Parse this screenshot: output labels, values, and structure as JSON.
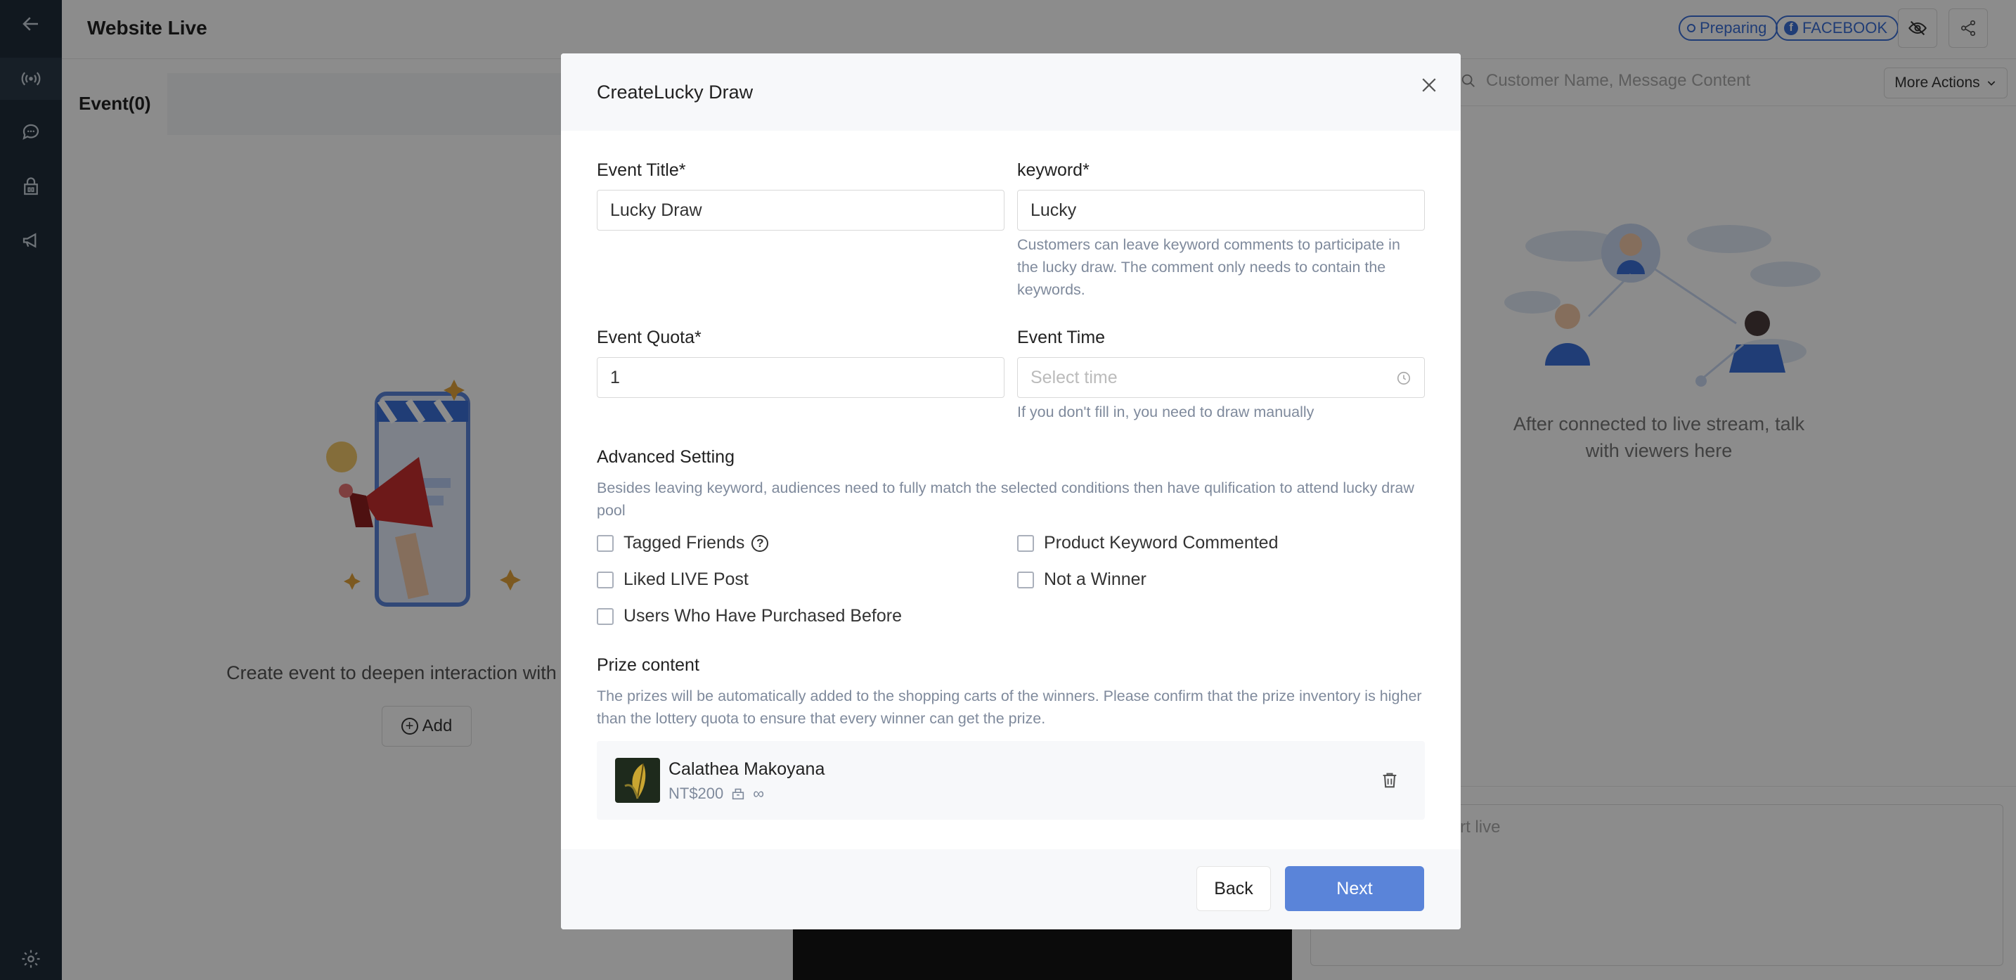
{
  "header": {
    "title": "Website Live",
    "status_pill": "Preparing",
    "platform_pill": "FACEBOOK",
    "platform_initial": "f"
  },
  "sidebar": {
    "icons": [
      "back-arrow-icon",
      "live-broadcast-icon",
      "chat-icon",
      "shop-icon",
      "megaphone-icon",
      "settings-icon"
    ]
  },
  "events_panel": {
    "tab_label": "Event(0)",
    "empty_text": "Create event to deepen interaction with",
    "add_label": "Add"
  },
  "right_panel": {
    "search_placeholder": "Customer Name, Message Content",
    "more_actions_label": "More Actions",
    "empty_text": "After connected to live stream, talk with viewers here",
    "comment_placeholder": "ment after you start live"
  },
  "modal": {
    "title": "CreateLucky Draw",
    "event_title_label": "Event Title*",
    "event_title_value": "Lucky Draw",
    "keyword_label": "keyword*",
    "keyword_value": "Lucky",
    "keyword_hint": "Customers can leave keyword comments to participate in the lucky draw. The comment only needs to contain the keywords.",
    "quota_label": "Event Quota*",
    "quota_value": "1",
    "time_label": "Event Time",
    "time_placeholder": "Select time",
    "time_hint": "If you don't fill in, you need to draw manually",
    "advanced_label": "Advanced Setting",
    "advanced_hint": "Besides leaving keyword, audiences need to fully match the selected conditions then have qulification to attend lucky draw pool",
    "conditions": {
      "tagged_friends": "Tagged Friends",
      "product_keyword": "Product Keyword Commented",
      "liked_post": "Liked LIVE Post",
      "not_winner": "Not a Winner",
      "purchased_before": "Users Who Have Purchased Before"
    },
    "prize_label": "Prize content",
    "prize_hint": "The prizes will be automatically added to the shopping carts of the winners. Please confirm that the prize inventory is higher than the lottery quota to ensure that every winner can get the prize.",
    "prize": {
      "name": "Calathea Makoyana",
      "price": "NT$200",
      "stock": "∞"
    },
    "back_label": "Back",
    "next_label": "Next"
  },
  "colors": {
    "sidebar": "#1f2d3a",
    "accent": "#3b6fd8",
    "primary_button": "#5a84d9"
  }
}
